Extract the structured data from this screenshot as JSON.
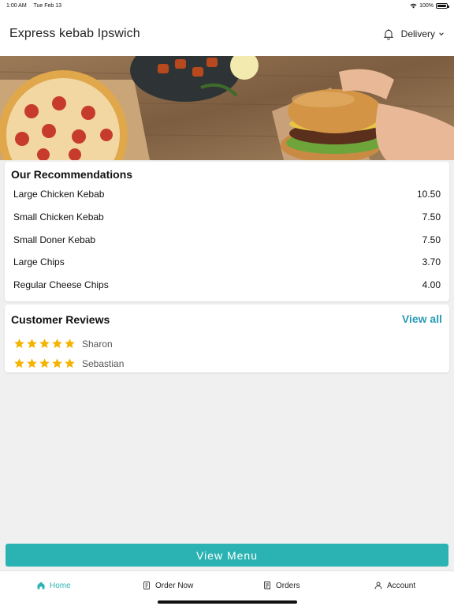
{
  "status_bar": {
    "time": "1:00 AM",
    "date": "Tue Feb 13",
    "battery": "100%"
  },
  "header": {
    "title": "Express kebab Ipswich",
    "mode": "Delivery"
  },
  "recommendations": {
    "title": "Our Recommendations",
    "items": [
      {
        "name": "Large Chicken Kebab",
        "price": "10.50"
      },
      {
        "name": "Small Chicken Kebab",
        "price": "7.50"
      },
      {
        "name": "Small Doner Kebab",
        "price": "7.50"
      },
      {
        "name": "Large Chips",
        "price": "3.70"
      },
      {
        "name": "Regular Cheese Chips",
        "price": "4.00"
      }
    ]
  },
  "reviews": {
    "title": "Customer Reviews",
    "view_all": "View all",
    "items": [
      {
        "name": "Sharon",
        "rating": 5
      },
      {
        "name": "Sebastian",
        "rating": 5
      }
    ]
  },
  "view_menu_label": "View Menu",
  "tabs": [
    {
      "label": "Home",
      "icon": "home-icon",
      "active": true
    },
    {
      "label": "Order Now",
      "icon": "order-icon",
      "active": false
    },
    {
      "label": "Orders",
      "icon": "receipt-icon",
      "active": false
    },
    {
      "label": "Account",
      "icon": "user-icon",
      "active": false
    }
  ],
  "colors": {
    "accent": "#2bb3b3",
    "link": "#2a9ab5",
    "star": "#f5b300"
  }
}
